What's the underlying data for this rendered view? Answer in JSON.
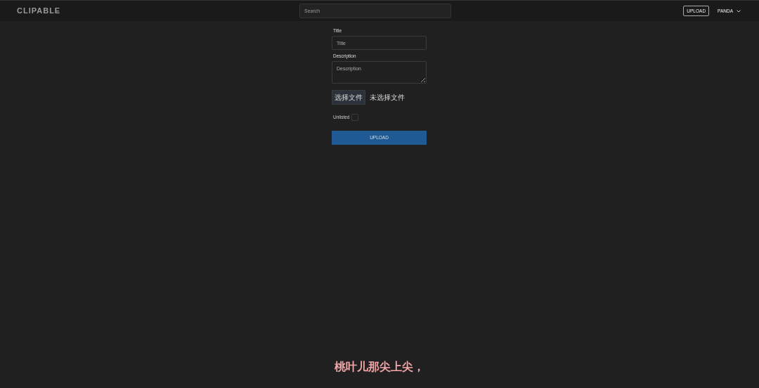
{
  "header": {
    "logo": "CLIPABLE",
    "search": {
      "placeholder": "Search"
    },
    "upload_button": "UPLOAD",
    "user_menu": "PANDA"
  },
  "form": {
    "title_label": "Title",
    "title_field": {
      "placeholder": "Title"
    },
    "description_label": "Description",
    "description_field": {
      "placeholder": "Description"
    },
    "file_button": "选择文件",
    "file_status": "未选择文件",
    "unlisted": {
      "label": "Unlisted",
      "checked": false
    },
    "submit_button": "UPLOAD"
  },
  "subtitle": "桃叶儿那尖上尖，"
}
